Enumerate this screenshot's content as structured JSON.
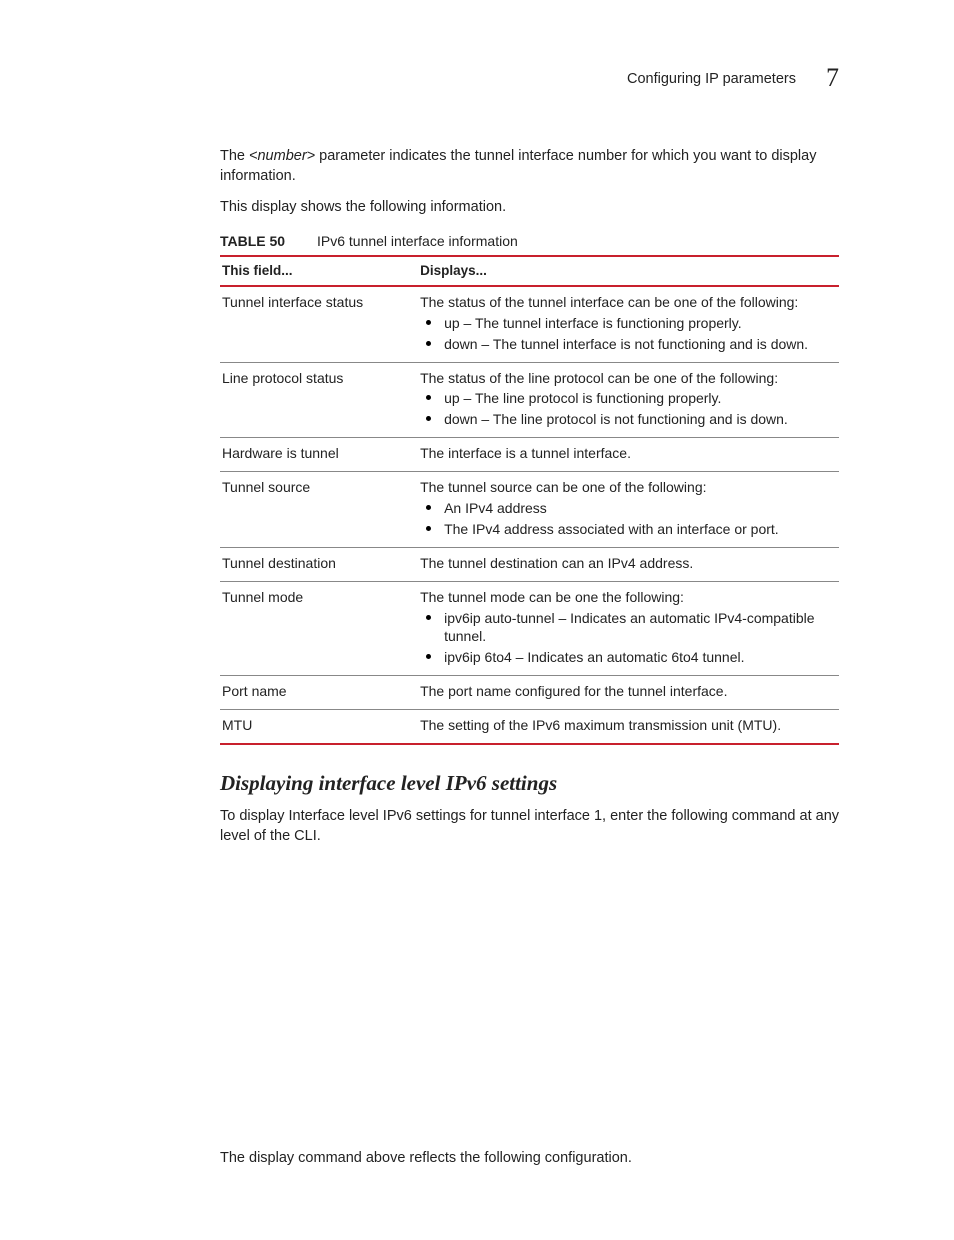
{
  "header": {
    "section_title": "Configuring IP parameters",
    "chapter_number": "7"
  },
  "para1_pre": "The ",
  "para1_param": "<number>",
  "para1_post": " parameter indicates the tunnel interface number for which you want to display information.",
  "para2": "This display shows the following information.",
  "table": {
    "label": "TABLE 50",
    "title": "IPv6 tunnel interface information",
    "col1": "This field...",
    "col2": "Displays...",
    "rows": [
      {
        "field": "Tunnel interface status",
        "intro": "The status of the tunnel interface can be one of the following:",
        "bullets": [
          "up – The tunnel interface is functioning properly.",
          "down – The tunnel interface is not functioning and is down."
        ]
      },
      {
        "field": "Line protocol status",
        "intro": "The status of the line protocol can be one of the following:",
        "bullets": [
          "up – The line protocol is functioning properly.",
          "down – The line protocol is not functioning and is down."
        ]
      },
      {
        "field": "Hardware is tunnel",
        "intro": "The interface is a tunnel interface.",
        "bullets": []
      },
      {
        "field": "Tunnel source",
        "intro": "The tunnel source can be one of the following:",
        "bullets": [
          "An IPv4 address",
          "The IPv4 address associated with an interface or port."
        ]
      },
      {
        "field": "Tunnel destination",
        "intro": "The tunnel destination can an IPv4 address.",
        "bullets": []
      },
      {
        "field": "Tunnel mode",
        "intro": "The tunnel mode can be one the following:",
        "bullets": [
          "ipv6ip auto-tunnel – Indicates an automatic IPv4-compatible tunnel.",
          "ipv6ip 6to4 – Indicates an automatic 6to4 tunnel."
        ]
      },
      {
        "field": "Port name",
        "intro": "The port name configured for the tunnel interface.",
        "bullets": []
      },
      {
        "field": "MTU",
        "intro": "The setting of the IPv6 maximum transmission unit (MTU).",
        "bullets": []
      }
    ]
  },
  "subheading": "Displaying interface level IPv6 settings",
  "sub_para": "To display Interface level IPv6 settings for tunnel interface 1, enter the following command at any level of the CLI.",
  "closing": "The display command above reflects the following configuration."
}
